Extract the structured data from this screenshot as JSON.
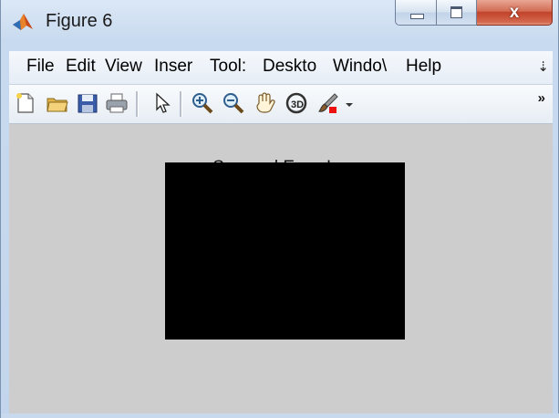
{
  "window": {
    "title": "Figure 6",
    "close_symbol": "x",
    "app_icon": "matlab-logo-icon"
  },
  "menubar": {
    "items": [
      "File",
      "Edit",
      "View",
      "Inser",
      "Tool:",
      "Deskto",
      "Windo\\",
      "Help"
    ],
    "overflow_symbol": "»"
  },
  "toolbar": {
    "icons": [
      "new-figure-icon",
      "open-file-icon",
      "save-icon",
      "print-icon",
      "pointer-icon",
      "zoom-in-icon",
      "zoom-out-icon",
      "pan-hand-icon",
      "rotate-3d-icon",
      "data-brush-icon"
    ],
    "overflow_symbol": "»"
  },
  "figure": {
    "plot_title": "Squared Error Image",
    "image_color": "#000000",
    "background_color": "#cdcdcd"
  }
}
